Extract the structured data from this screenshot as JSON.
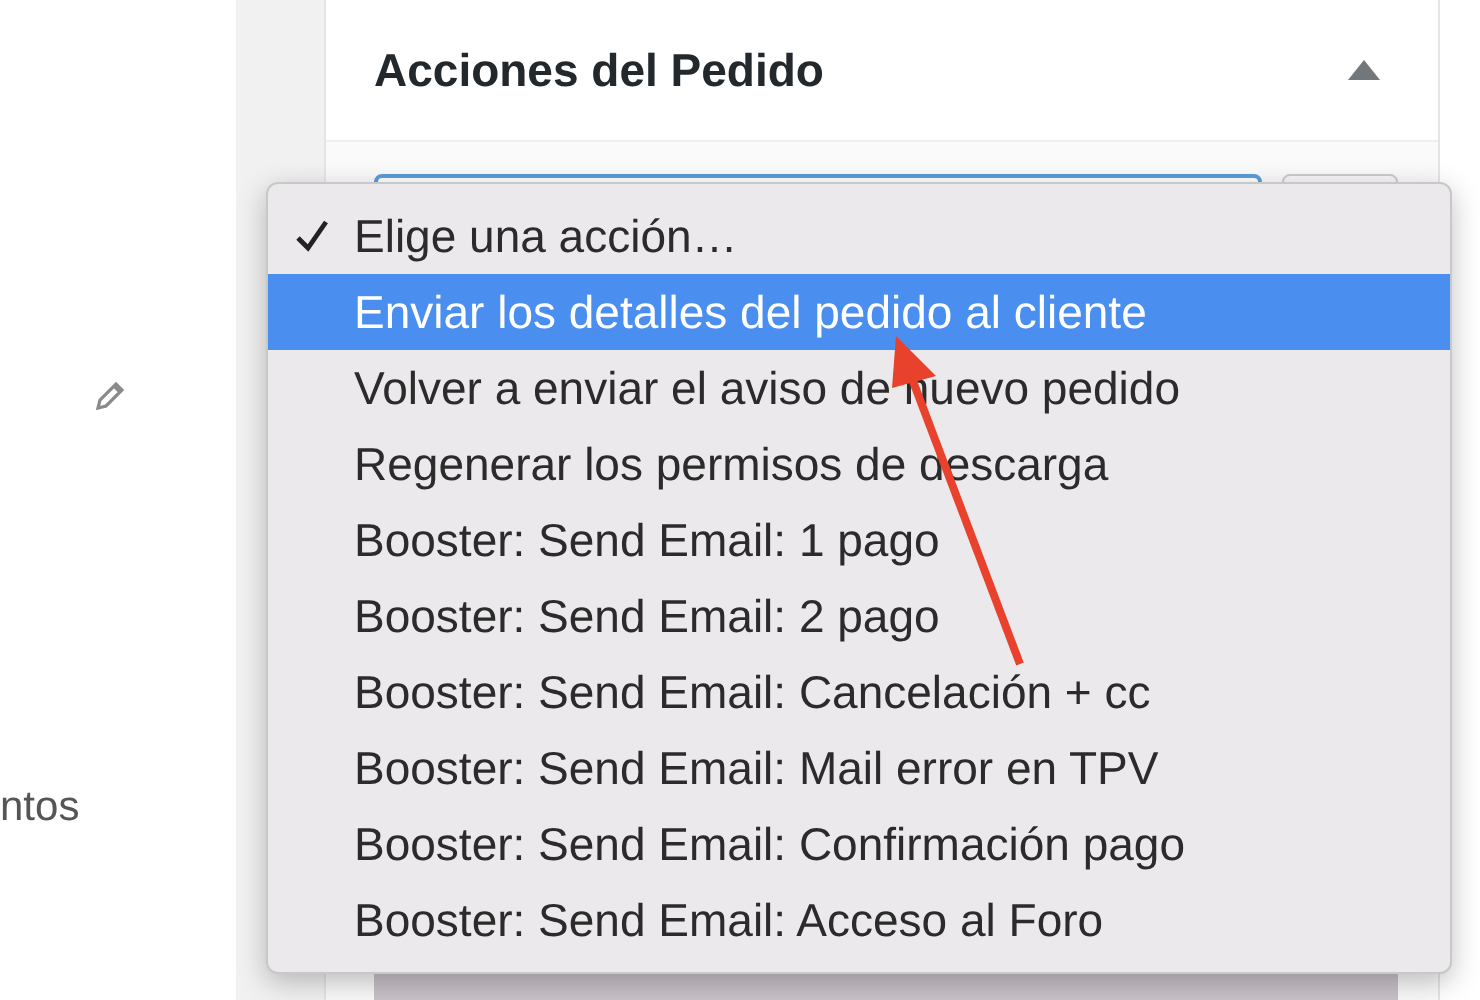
{
  "sidebar": {
    "partial_label": "ntos"
  },
  "panel": {
    "title": "Acciones del Pedido",
    "expanded": true
  },
  "dropdown": {
    "items": [
      {
        "label": "Elige una acción…",
        "checked": true,
        "selected": false
      },
      {
        "label": "Enviar los detalles del pedido al cliente",
        "checked": false,
        "selected": true
      },
      {
        "label": "Volver a enviar el aviso de nuevo pedido",
        "checked": false,
        "selected": false
      },
      {
        "label": "Regenerar los permisos de descarga",
        "checked": false,
        "selected": false
      },
      {
        "label": "Booster: Send Email: 1 pago",
        "checked": false,
        "selected": false
      },
      {
        "label": "Booster: Send Email: 2 pago",
        "checked": false,
        "selected": false
      },
      {
        "label": "Booster: Send Email: Cancelación + cc",
        "checked": false,
        "selected": false
      },
      {
        "label": "Booster: Send Email: Mail error en TPV",
        "checked": false,
        "selected": false
      },
      {
        "label": "Booster: Send Email: Confirmación pago",
        "checked": false,
        "selected": false
      },
      {
        "label": "Booster: Send Email: Acceso al Foro",
        "checked": false,
        "selected": false
      }
    ]
  }
}
